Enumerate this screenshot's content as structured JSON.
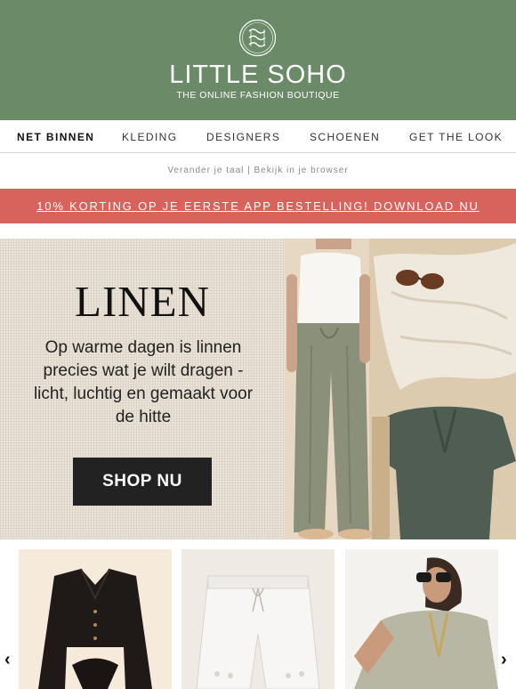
{
  "brand": {
    "name": "LITTLE SOHO",
    "tagline": "THE ONLINE FASHION BOUTIQUE",
    "logo_icon": "soho-monogram-icon",
    "header_color": "#6a8a68"
  },
  "nav": {
    "items": [
      {
        "label": "NET BINNEN"
      },
      {
        "label": "KLEDING"
      },
      {
        "label": "DESIGNERS"
      },
      {
        "label": "SCHOENEN"
      },
      {
        "label": "GET THE LOOK"
      }
    ]
  },
  "utility": {
    "text": "Verander je taal | Bekijk in je browser"
  },
  "promo": {
    "text": "10% KORTING OP JE EERSTE APP BESTELLING! DOWNLOAD NU",
    "color": "#d8625c"
  },
  "hero": {
    "title": "LINEN",
    "text": "Op warme dagen is linnen precies wat je wilt dragen - licht, luchtig en gemaakt voor de hitte",
    "button_label": "SHOP NU"
  },
  "carousel": {
    "prev_icon": "chevron-left-icon",
    "next_icon": "chevron-right-icon",
    "prev_glyph": "‹",
    "next_glyph": "›",
    "products": [
      {
        "image": "black-linen-tie-front-blouse"
      },
      {
        "image": "white-linen-shorts-eyelet"
      },
      {
        "image": "sage-linen-tunic-model"
      }
    ]
  }
}
